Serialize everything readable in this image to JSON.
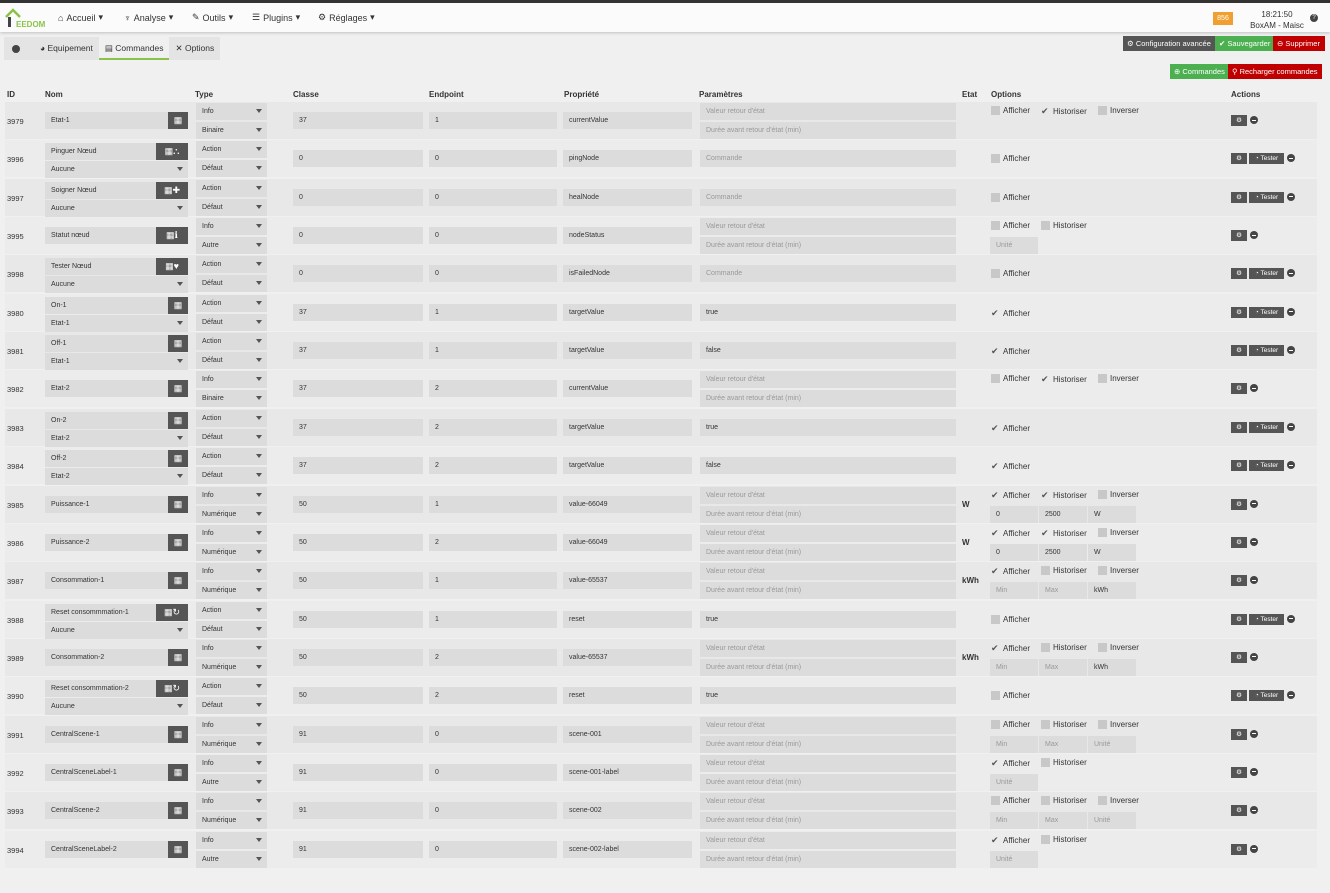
{
  "header": {
    "logo": "JEEDOM",
    "menus": [
      "Accueil",
      "Analyse",
      "Outils",
      "Plugins",
      "Réglages"
    ],
    "badge": "856",
    "time": "18:21:50",
    "box": "BoxAM - Maisc"
  },
  "tabs": [
    "Equipement",
    "Commandes",
    "Options"
  ],
  "buttons": {
    "config": "Configuration avancée",
    "save": "Sauvegarder",
    "delete": "Supprimer",
    "add_cmd": "Commandes",
    "reload": "Recharger commandes",
    "tester": "Tester"
  },
  "columns": {
    "id": "ID",
    "name": "Nom",
    "type": "Type",
    "classe": "Classe",
    "endpoint": "Endpoint",
    "prop": "Propriété",
    "params": "Paramètres",
    "etat": "Etat",
    "options": "Options",
    "actions": "Actions"
  },
  "labels": {
    "afficher": "Afficher",
    "historiser": "Historiser",
    "inverser": "Inverser",
    "ph_val": "Valeur retour d'état",
    "ph_dur": "Durée avant retour d'état (min)",
    "ph_cmd": "Commande",
    "ph_min": "Min",
    "ph_max": "Max",
    "ph_unit": "Unité"
  },
  "colors": {
    "green": "#4caf50",
    "red": "#c00000",
    "dark": "#555555",
    "orange": "#f0a030"
  },
  "rows": [
    {
      "id": "3979",
      "name": "Etat-1",
      "icon": "",
      "type": "Info",
      "sub": "Binaire",
      "classe": "37",
      "ep": "1",
      "prop": "currentValue",
      "aff": 0,
      "hist": 1,
      "inv": 0
    },
    {
      "id": "3996",
      "name": "Pinguer Nœud",
      "icon": "sitemap-icon",
      "value": "Aucune",
      "type": "Action",
      "sub": "Défaut",
      "classe": "0",
      "ep": "0",
      "prop": "pingNode",
      "aff": 0
    },
    {
      "id": "3997",
      "name": "Soigner Nœud",
      "icon": "medkit-icon",
      "value": "Aucune",
      "type": "Action",
      "sub": "Défaut",
      "classe": "0",
      "ep": "0",
      "prop": "healNode",
      "aff": 0
    },
    {
      "id": "3995",
      "name": "Statut nœud",
      "icon": "info-icon",
      "type": "Info",
      "sub": "Autre",
      "classe": "0",
      "ep": "0",
      "prop": "nodeStatus",
      "aff": 0,
      "hist": 0,
      "unitOnly": 1
    },
    {
      "id": "3998",
      "name": "Tester Nœud",
      "icon": "heartbeat-icon",
      "value": "Aucune",
      "type": "Action",
      "sub": "Défaut",
      "classe": "0",
      "ep": "0",
      "prop": "isFailedNode",
      "aff": 0
    },
    {
      "id": "3980",
      "name": "On-1",
      "icon": "",
      "value": "Etat-1",
      "type": "Action",
      "sub": "Défaut",
      "classe": "37",
      "ep": "1",
      "prop": "targetValue",
      "param": "true",
      "aff": 1
    },
    {
      "id": "3981",
      "name": "Off-1",
      "icon": "",
      "value": "Etat-1",
      "type": "Action",
      "sub": "Défaut",
      "classe": "37",
      "ep": "1",
      "prop": "targetValue",
      "param": "false",
      "aff": 1
    },
    {
      "id": "3982",
      "name": "Etat-2",
      "icon": "",
      "type": "Info",
      "sub": "Binaire",
      "classe": "37",
      "ep": "2",
      "prop": "currentValue",
      "aff": 0,
      "hist": 1,
      "inv": 0
    },
    {
      "id": "3983",
      "name": "On-2",
      "icon": "",
      "value": "Etat-2",
      "type": "Action",
      "sub": "Défaut",
      "classe": "37",
      "ep": "2",
      "prop": "targetValue",
      "param": "true",
      "aff": 1
    },
    {
      "id": "3984",
      "name": "Off-2",
      "icon": "",
      "value": "Etat-2",
      "type": "Action",
      "sub": "Défaut",
      "classe": "37",
      "ep": "2",
      "prop": "targetValue",
      "param": "false",
      "aff": 1
    },
    {
      "id": "3985",
      "name": "Puissance-1",
      "icon": "",
      "type": "Info",
      "sub": "Numérique",
      "classe": "50",
      "ep": "1",
      "prop": "value-66049",
      "unit": "W",
      "aff": 1,
      "hist": 1,
      "inv": 0,
      "min": "0",
      "max": "2500",
      "u": "W"
    },
    {
      "id": "3986",
      "name": "Puissance-2",
      "icon": "",
      "type": "Info",
      "sub": "Numérique",
      "classe": "50",
      "ep": "2",
      "prop": "value-66049",
      "unit": "W",
      "aff": 1,
      "hist": 1,
      "inv": 0,
      "min": "0",
      "max": "2500",
      "u": "W"
    },
    {
      "id": "3987",
      "name": "Consommation-1",
      "icon": "",
      "type": "Info",
      "sub": "Numérique",
      "classe": "50",
      "ep": "1",
      "prop": "value-65537",
      "unit": "kWh",
      "aff": 1,
      "hist": 0,
      "inv": 0,
      "min": "",
      "max": "",
      "u": "kWh"
    },
    {
      "id": "3988",
      "name": "Reset consommmation-1",
      "icon": "refresh-icon",
      "value": "Aucune",
      "type": "Action",
      "sub": "Défaut",
      "classe": "50",
      "ep": "1",
      "prop": "reset",
      "param": "true",
      "aff": 0
    },
    {
      "id": "3989",
      "name": "Consommation-2",
      "icon": "",
      "type": "Info",
      "sub": "Numérique",
      "classe": "50",
      "ep": "2",
      "prop": "value-65537",
      "unit": "kWh",
      "aff": 1,
      "hist": 0,
      "inv": 0,
      "min": "",
      "max": "",
      "u": "kWh"
    },
    {
      "id": "3990",
      "name": "Reset consommmation-2",
      "icon": "refresh-icon",
      "value": "Aucune",
      "type": "Action",
      "sub": "Défaut",
      "classe": "50",
      "ep": "2",
      "prop": "reset",
      "param": "true",
      "aff": 0
    },
    {
      "id": "3991",
      "name": "CentralScene-1",
      "icon": "",
      "type": "Info",
      "sub": "Numérique",
      "classe": "91",
      "ep": "0",
      "prop": "scene-001",
      "aff": 0,
      "hist": 0,
      "inv": 0,
      "min": "",
      "max": "",
      "u": ""
    },
    {
      "id": "3992",
      "name": "CentralSceneLabel-1",
      "icon": "",
      "type": "Info",
      "sub": "Autre",
      "classe": "91",
      "ep": "0",
      "prop": "scene-001-label",
      "aff": 1,
      "hist": 0,
      "unitOnly": 1
    },
    {
      "id": "3993",
      "name": "CentralScene-2",
      "icon": "",
      "type": "Info",
      "sub": "Numérique",
      "classe": "91",
      "ep": "0",
      "prop": "scene-002",
      "aff": 0,
      "hist": 0,
      "inv": 0,
      "min": "",
      "max": "",
      "u": ""
    },
    {
      "id": "3994",
      "name": "CentralSceneLabel-2",
      "icon": "",
      "type": "Info",
      "sub": "Autre",
      "classe": "91",
      "ep": "0",
      "prop": "scene-002-label",
      "aff": 1,
      "hist": 0,
      "unitOnly": 1
    }
  ]
}
